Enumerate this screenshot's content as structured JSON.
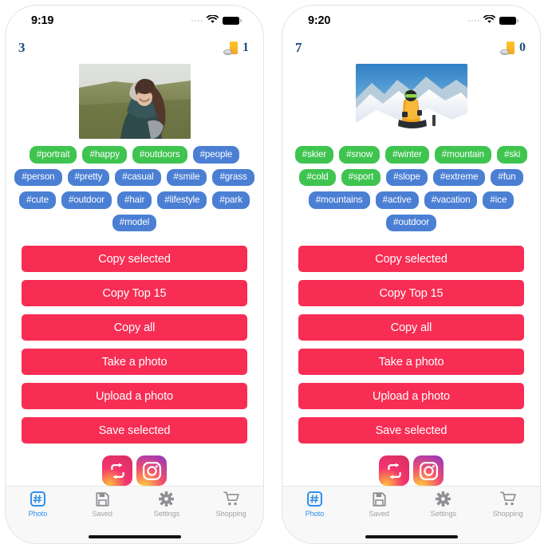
{
  "phones": [
    {
      "id": "left",
      "status": {
        "time": "9:19",
        "wifi_icon": "wifi-icon",
        "battery_icon": "battery-full-icon"
      },
      "header": {
        "tag_count": "3",
        "coin_icon": "coin-stack-icon",
        "coin_count": "1"
      },
      "photo": {
        "alt": "smiling-woman-in-field-photo"
      },
      "tags": [
        {
          "label": "#portrait",
          "color": "green"
        },
        {
          "label": "#happy",
          "color": "green"
        },
        {
          "label": "#outdoors",
          "color": "green"
        },
        {
          "label": "#people",
          "color": "blue"
        },
        {
          "label": "#person",
          "color": "blue"
        },
        {
          "label": "#pretty",
          "color": "blue"
        },
        {
          "label": "#casual",
          "color": "blue"
        },
        {
          "label": "#smile",
          "color": "blue"
        },
        {
          "label": "#grass",
          "color": "blue"
        },
        {
          "label": "#cute",
          "color": "blue"
        },
        {
          "label": "#outdoor",
          "color": "blue"
        },
        {
          "label": "#hair",
          "color": "blue"
        },
        {
          "label": "#lifestyle",
          "color": "blue"
        },
        {
          "label": "#park",
          "color": "blue"
        },
        {
          "label": "#model",
          "color": "blue"
        }
      ],
      "actions": [
        "Copy selected",
        "Copy Top 15",
        "Copy all",
        "Take a photo",
        "Upload a photo",
        "Save selected"
      ],
      "socials": [
        {
          "name": "repost-icon"
        },
        {
          "name": "instagram-icon"
        }
      ],
      "tabs": [
        {
          "label": "Photo",
          "icon": "hashtag-icon",
          "active": true
        },
        {
          "label": "Saved",
          "icon": "floppy-disk-icon",
          "active": false
        },
        {
          "label": "Settings",
          "icon": "gear-icon",
          "active": false
        },
        {
          "label": "Shopping",
          "icon": "shopping-cart-icon",
          "active": false
        }
      ]
    },
    {
      "id": "right",
      "status": {
        "time": "9:20",
        "wifi_icon": "wifi-icon",
        "battery_icon": "battery-full-icon"
      },
      "header": {
        "tag_count": "7",
        "coin_icon": "coin-stack-icon",
        "coin_count": "0"
      },
      "photo": {
        "alt": "skier-on-snowy-mountain-photo"
      },
      "tags": [
        {
          "label": "#skier",
          "color": "green"
        },
        {
          "label": "#snow",
          "color": "green"
        },
        {
          "label": "#winter",
          "color": "green"
        },
        {
          "label": "#mountain",
          "color": "green"
        },
        {
          "label": "#ski",
          "color": "green"
        },
        {
          "label": "#cold",
          "color": "green"
        },
        {
          "label": "#sport",
          "color": "green"
        },
        {
          "label": "#slope",
          "color": "blue"
        },
        {
          "label": "#extreme",
          "color": "blue"
        },
        {
          "label": "#fun",
          "color": "blue"
        },
        {
          "label": "#mountains",
          "color": "blue"
        },
        {
          "label": "#active",
          "color": "blue"
        },
        {
          "label": "#vacation",
          "color": "blue"
        },
        {
          "label": "#ice",
          "color": "blue"
        },
        {
          "label": "#outdoor",
          "color": "blue"
        }
      ],
      "actions": [
        "Copy selected",
        "Copy Top 15",
        "Copy all",
        "Take a photo",
        "Upload a photo",
        "Save selected"
      ],
      "socials": [
        {
          "name": "repost-icon"
        },
        {
          "name": "instagram-icon"
        }
      ],
      "tabs": [
        {
          "label": "Photo",
          "icon": "hashtag-icon",
          "active": true
        },
        {
          "label": "Saved",
          "icon": "floppy-disk-icon",
          "active": false
        },
        {
          "label": "Settings",
          "icon": "gear-icon",
          "active": false
        },
        {
          "label": "Shopping",
          "icon": "shopping-cart-icon",
          "active": false
        }
      ]
    }
  ],
  "colors": {
    "tag_green": "#3ec44f",
    "tag_blue": "#4a7fd4",
    "button_pink": "#f72d54",
    "counter_blue": "#1f4e79",
    "tab_active": "#2f8ee8",
    "tab_inactive": "#a0a2a7"
  }
}
